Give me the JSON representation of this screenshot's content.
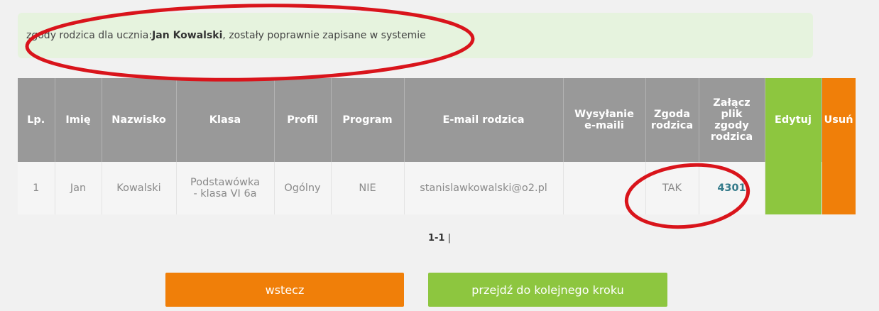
{
  "alert": {
    "prefix": "zgody rodzica dla ucznia: ",
    "student_name": "Jan Kowalski",
    "suffix": ", zostały poprawnie zapisane w systemie"
  },
  "table": {
    "headers": {
      "lp": "Lp.",
      "imie": "Imię",
      "nazwisko": "Nazwisko",
      "klasa": "Klasa",
      "profil": "Profil",
      "program": "Program",
      "email": "E-mail rodzica",
      "wysylanie_line1": "Wysyłanie",
      "wysylanie_line2": "e-maili",
      "zgoda_line1": "Zgoda",
      "zgoda_line2": "rodzica",
      "zalacz_line1": "Załącz",
      "zalacz_line2": "plik",
      "zalacz_line3": "zgody",
      "zalacz_line4": "rodzica",
      "edytuj": "Edytuj",
      "usun": "Usuń"
    },
    "rows": [
      {
        "lp": "1",
        "imie": "Jan",
        "nazwisko": "Kowalski",
        "klasa_line1": "Podstawówka",
        "klasa_line2": "- klasa VI 6a",
        "profil": "Ogólny",
        "program": "NIE",
        "email": "stanislawkowalski@o2.pl",
        "wysylanie": "",
        "zgoda": "TAK",
        "plik": "4301"
      }
    ]
  },
  "pagination": {
    "range": "1-1",
    "separator": " |"
  },
  "buttons": {
    "back": "wstecz",
    "next": "przejdź do kolejnego kroku"
  },
  "colors": {
    "header_gray": "#999999",
    "edit_green": "#8dc63f",
    "delete_orange": "#f07f09",
    "alert_bg": "#e6f3de",
    "annotation_red": "#d9141b"
  }
}
